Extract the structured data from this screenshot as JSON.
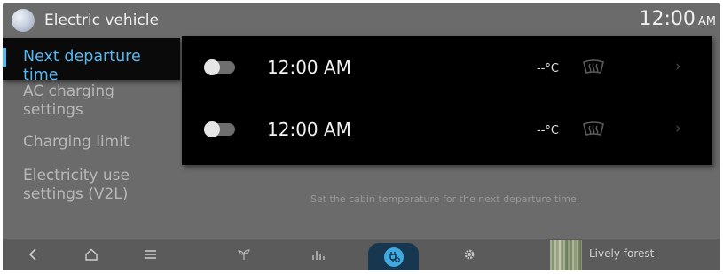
{
  "header": {
    "app_icon": "electric-vehicle-app-icon",
    "title": "Electric vehicle",
    "clock_time": "12:00",
    "clock_ampm": "AM"
  },
  "menu": {
    "items": [
      {
        "label": "Next departure time",
        "active": true
      },
      {
        "label": "AC charging settings",
        "active": false
      },
      {
        "label": "Charging limit",
        "active": false
      },
      {
        "label": "Electricity use settings (V2L)",
        "active": false
      }
    ],
    "accent_color": "#5ab8f0"
  },
  "schedule": {
    "rows": [
      {
        "enabled": false,
        "time": "12:00 AM",
        "temperature": "--°C",
        "defrost_icon": "windshield-defrost-icon",
        "chevron_icon": "chevron-right-icon"
      },
      {
        "enabled": false,
        "time": "12:00 AM",
        "temperature": "--°C",
        "defrost_icon": "windshield-defrost-icon",
        "chevron_icon": "chevron-right-icon"
      }
    ],
    "hint": "Set the cabin temperature for the next departure time."
  },
  "navbar": {
    "items": [
      {
        "icon": "back-icon"
      },
      {
        "icon": "home-icon"
      },
      {
        "icon": "menu-icon"
      },
      {
        "icon": "sprout-icon"
      },
      {
        "icon": "bar-chart-icon"
      },
      {
        "icon": "ev-charging-icon",
        "active": true
      },
      {
        "icon": "settings-gear-icon"
      }
    ],
    "active_color": "#41a8e2",
    "media": {
      "label": "Lively forest"
    }
  }
}
